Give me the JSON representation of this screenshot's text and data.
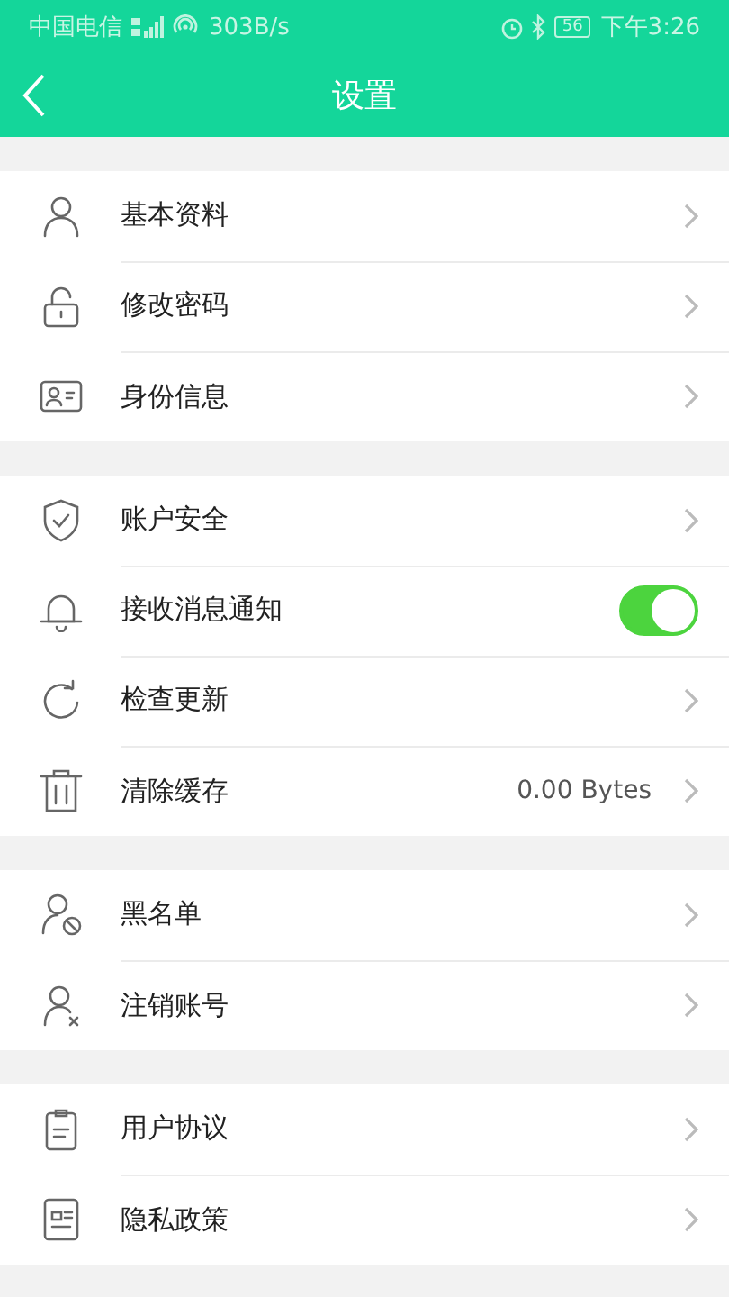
{
  "status_bar": {
    "carrier": "中国电信",
    "speed": "303B/s",
    "battery": "56",
    "time": "下午3:26"
  },
  "header": {
    "title": "设置"
  },
  "groups": [
    {
      "items": [
        {
          "label": "基本资料",
          "kind": "link"
        },
        {
          "label": "修改密码",
          "kind": "link"
        },
        {
          "label": "身份信息",
          "kind": "link"
        }
      ]
    },
    {
      "items": [
        {
          "label": "账户安全",
          "kind": "link"
        },
        {
          "label": "接收消息通知",
          "kind": "toggle",
          "on": true
        },
        {
          "label": "检查更新",
          "kind": "link"
        },
        {
          "label": "清除缓存",
          "kind": "value",
          "value": "0.00 Bytes"
        }
      ]
    },
    {
      "items": [
        {
          "label": "黑名单",
          "kind": "link"
        },
        {
          "label": "注销账号",
          "kind": "link"
        }
      ]
    },
    {
      "items": [
        {
          "label": "用户协议",
          "kind": "link"
        },
        {
          "label": "隐私政策",
          "kind": "link"
        }
      ]
    }
  ]
}
